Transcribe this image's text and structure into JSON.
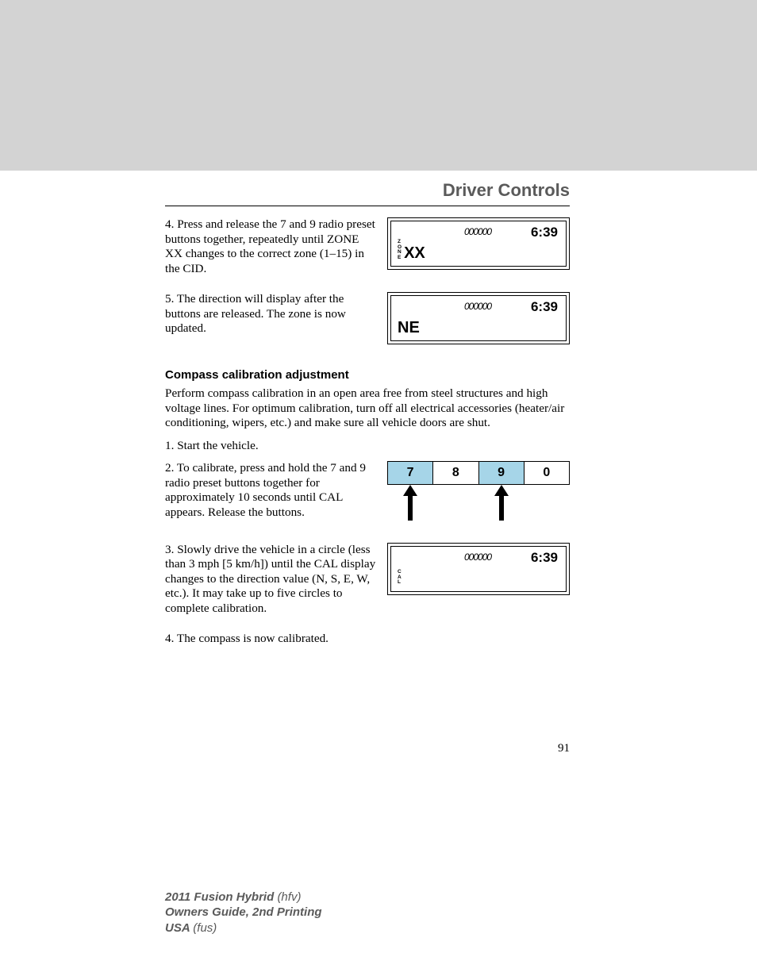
{
  "section_title": "Driver Controls",
  "step4": "4. Press and release the 7 and 9 radio preset buttons together, repeatedly until ZONE XX changes to the correct zone (1–15) in the CID.",
  "step5": "5. The direction will display after the buttons are released. The zone is now updated.",
  "subhead": "Compass calibration adjustment",
  "calib_intro": "Perform compass calibration in an open area free from steel structures and high voltage lines. For optimum calibration, turn off all electrical accessories (heater/air conditioning, wipers, etc.) and make sure all vehicle doors are shut.",
  "calib1": "1. Start the vehicle.",
  "calib2": "2. To calibrate, press and hold the 7 and 9 radio preset buttons together for approximately 10 seconds until CAL appears. Release the buttons.",
  "calib3": "3. Slowly drive the vehicle in a circle (less than 3 mph [5 km/h]) until the CAL display changes to the direction value (N, S, E, W, etc.). It may take up to five circles to complete calibration.",
  "calib4": "4. The compass is now calibrated.",
  "cid": {
    "odo": "000000",
    "time": "6:39",
    "zone_label_chars": [
      "Z",
      "O",
      "N",
      "E"
    ],
    "zone_value": "XX",
    "direction": "NE",
    "cal_label_chars": [
      "C",
      "A",
      "L"
    ]
  },
  "presets": [
    "7",
    "8",
    "9",
    "0"
  ],
  "page_number": "91",
  "footer": {
    "l1a": "2011 Fusion Hybrid ",
    "l1b": "(hfv)",
    "l2": "Owners Guide, 2nd Printing",
    "l3a": "USA ",
    "l3b": "(fus)"
  }
}
